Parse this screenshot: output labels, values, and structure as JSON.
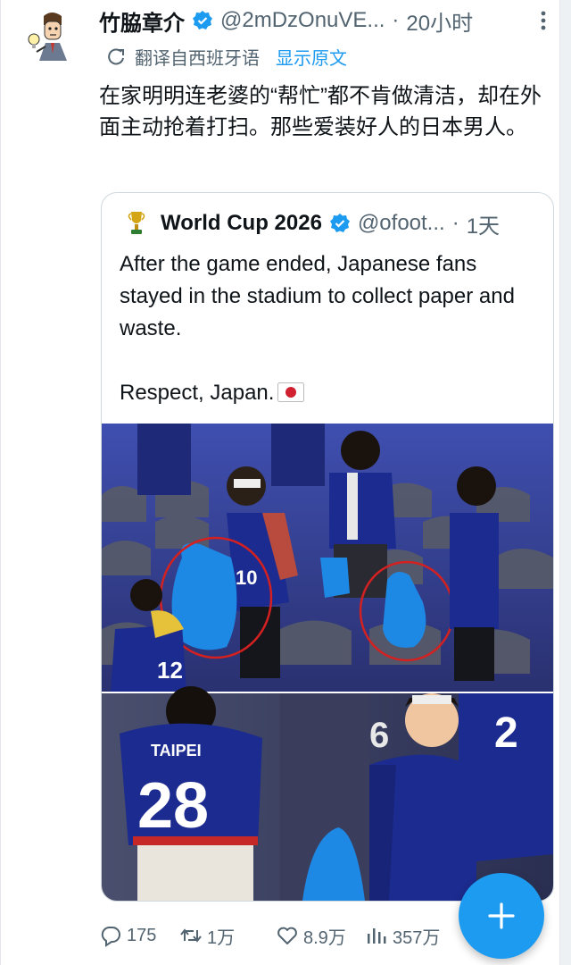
{
  "tweet": {
    "display_name": "竹脇章介",
    "handle": "@2mDzOnuVE...",
    "dot": "·",
    "time": "20小时",
    "translated_from": "翻译自西班牙语",
    "show_original": "显示原文",
    "text": "在家明明连老婆的“帮忙”都不肯做清洁，却在外面主动抢着打扫。那些爱装好人的日本男人。"
  },
  "quote": {
    "display_name": "World Cup 2026",
    "handle": "@ofoot...",
    "dot": "·",
    "time": "1天",
    "paragraph1": "After the game ended, Japanese fans stayed in the stadium to collect paper and waste.",
    "paragraph2": "Respect, Japan.",
    "photo_top": {
      "jersey_front": "10",
      "jersey_back": "12"
    },
    "photo_bottom": {
      "jersey_name": "TAIPEI",
      "jersey_number": "28",
      "jersey_far": "2",
      "jersey_mid": "6"
    }
  },
  "actions": {
    "replies": "175",
    "retweets": "1万",
    "likes": "8.9万",
    "views": "357万"
  },
  "colors": {
    "accent": "#1d9bf0",
    "text": "#0f1419",
    "secondary": "#536471",
    "jersey": "#1c2b8f"
  }
}
